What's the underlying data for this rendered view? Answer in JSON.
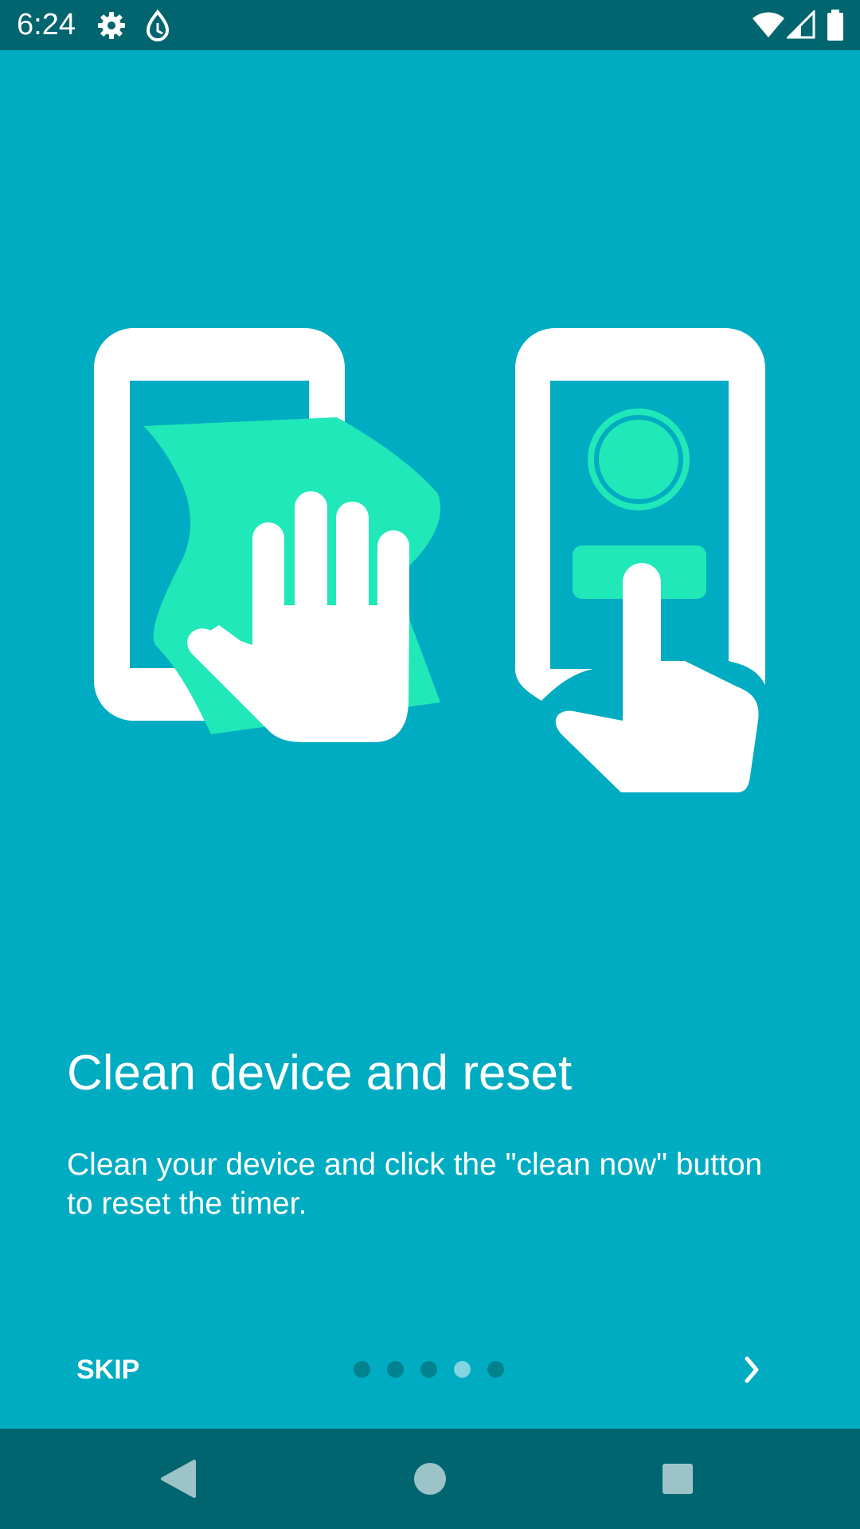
{
  "status_bar": {
    "time": "6:24",
    "icons": [
      "gear-icon",
      "water-drop-icon",
      "wifi-icon",
      "cellular-signal-icon",
      "battery-icon"
    ]
  },
  "onboarding": {
    "title": "Clean device and reset",
    "description": "Clean your device and click the \"clean now\" button to reset the timer.",
    "skip_label": "SKIP",
    "page_count": 5,
    "current_page": 4,
    "next_icon": "chevron-right-icon"
  },
  "colors": {
    "background": "#00ACC1",
    "system_bars": "#00656F",
    "accent_green": "#20E8B8",
    "dot_inactive": "#00828F",
    "dot_active": "#80D5E0",
    "nav_icons": "#9CC4C8"
  },
  "nav_bar": {
    "icons": [
      "back-icon",
      "home-icon",
      "recents-icon"
    ]
  }
}
